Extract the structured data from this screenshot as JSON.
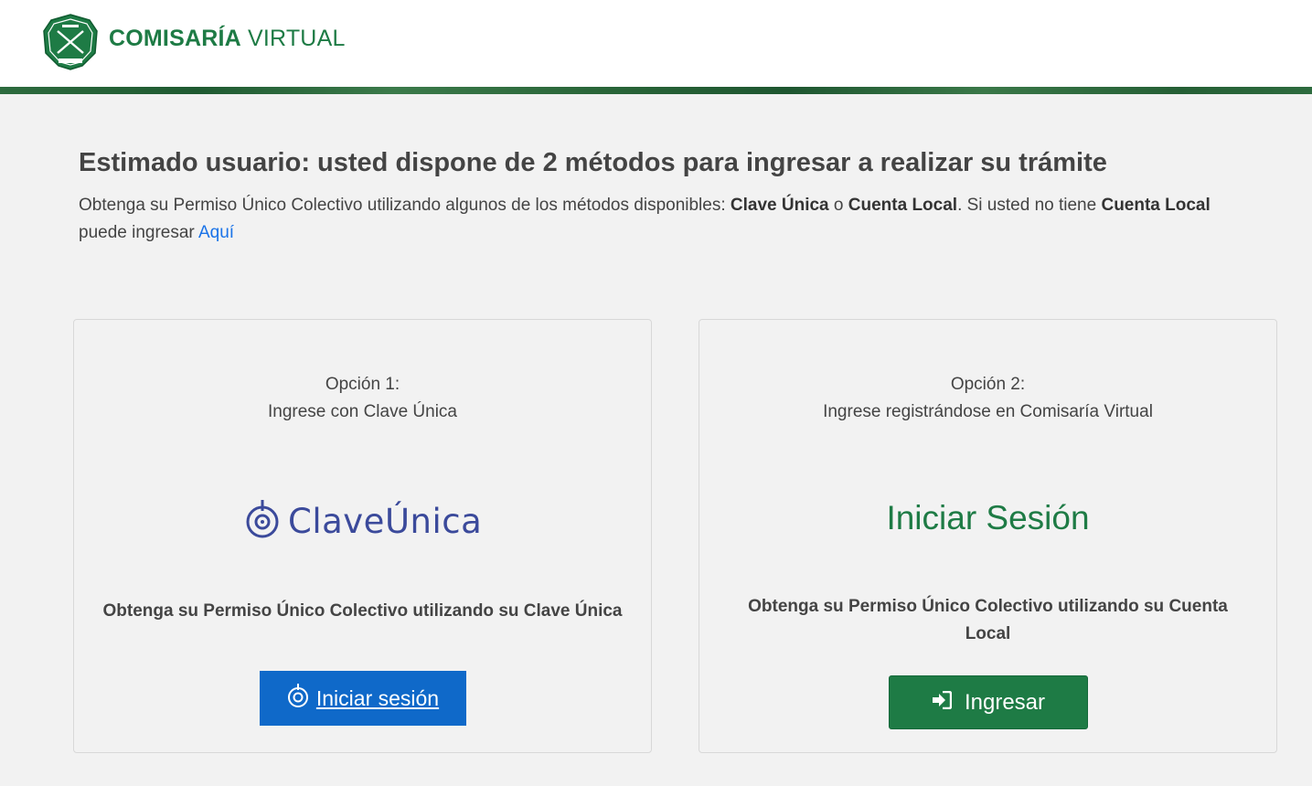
{
  "header": {
    "brand_bold": "COMISARÍA",
    "brand_light": "VIRTUAL",
    "logo_icon": "carabineros-shield-icon"
  },
  "intro": {
    "headline": "Estimado usuario: usted dispone de 2 métodos para ingresar a realizar su trámite",
    "p_part1": "Obtenga su Permiso Único Colectivo utilizando algunos de los métodos disponibles: ",
    "p_bold1": "Clave Única",
    "p_part2": " o ",
    "p_bold2": "Cuenta Local",
    "p_part3": ". Si usted no tiene ",
    "p_bold3": "Cuenta Local",
    "p_part4": " puede ingresar ",
    "link": "Aquí"
  },
  "option1": {
    "label": "Opción 1:",
    "subtitle": "Ingrese con Clave Única",
    "logo_text": "ClaveÚnica",
    "description": "Obtenga su Permiso Único Colectivo utilizando su Clave Única",
    "button": "Iniciar sesión"
  },
  "option2": {
    "label": "Opción 2:",
    "subtitle": "Ingrese registrándose en Comisaría Virtual",
    "heading": "Iniciar Sesión",
    "description": "Obtenga su Permiso Único Colectivo utilizando su Cuenta Local",
    "button": "Ingresar"
  },
  "colors": {
    "brand_green": "#1e7b45",
    "claveunica_blue": "#0f69c9",
    "claveunica_logo": "#3b4a9b",
    "link_blue": "#1a73e8"
  }
}
